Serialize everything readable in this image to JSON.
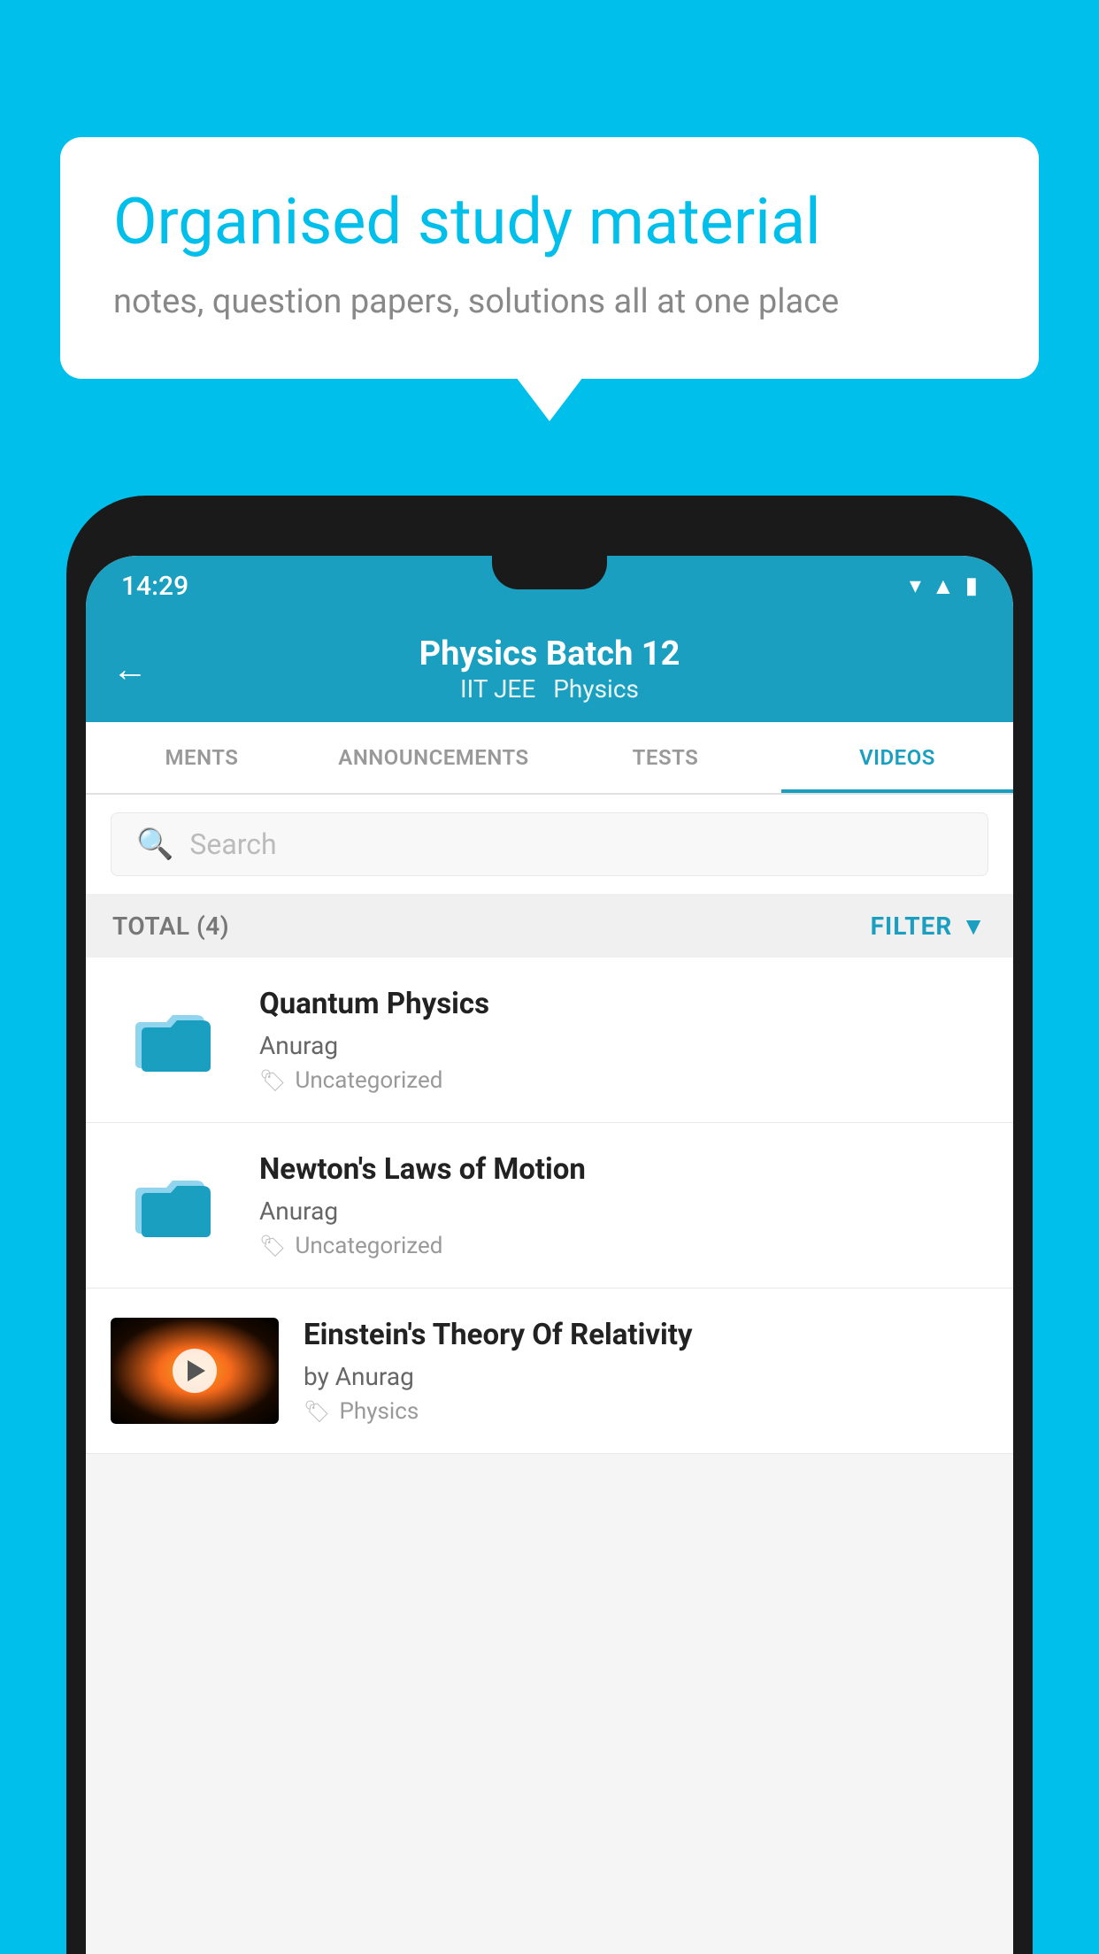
{
  "background": {
    "color": "#00BFEA"
  },
  "speech_bubble": {
    "title": "Organised study material",
    "subtitle": "notes, question papers, solutions all at one place"
  },
  "phone": {
    "status_bar": {
      "time": "14:29",
      "icons": [
        "wifi",
        "signal",
        "battery"
      ]
    },
    "app_bar": {
      "back_label": "←",
      "title": "Physics Batch 12",
      "subtitle_parts": [
        "IIT JEE",
        "Physics"
      ]
    },
    "tabs": [
      {
        "label": "MENTS",
        "active": false
      },
      {
        "label": "ANNOUNCEMENTS",
        "active": false
      },
      {
        "label": "TESTS",
        "active": false
      },
      {
        "label": "VIDEOS",
        "active": true
      }
    ],
    "search": {
      "placeholder": "Search"
    },
    "filter_bar": {
      "total_label": "TOTAL (4)",
      "filter_label": "FILTER"
    },
    "video_items": [
      {
        "type": "folder",
        "title": "Quantum Physics",
        "author": "Anurag",
        "tag": "Uncategorized"
      },
      {
        "type": "folder",
        "title": "Newton's Laws of Motion",
        "author": "Anurag",
        "tag": "Uncategorized"
      },
      {
        "type": "video",
        "title": "Einstein's Theory Of Relativity",
        "author": "by Anurag",
        "tag": "Physics"
      }
    ]
  }
}
